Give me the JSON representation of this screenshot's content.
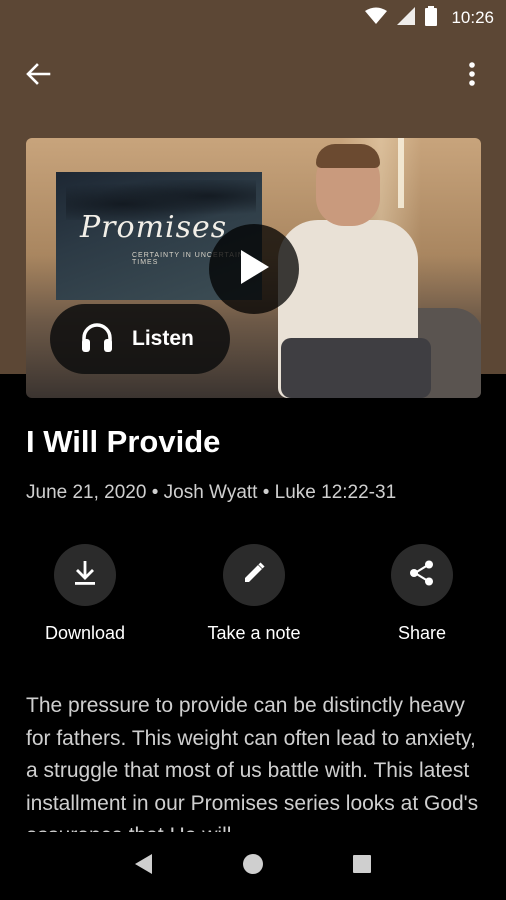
{
  "status_bar": {
    "time": "10:26",
    "icons": [
      "wifi-icon",
      "signal-icon",
      "battery-icon"
    ]
  },
  "app_bar": {
    "back_icon": "arrow-back-icon",
    "menu_icon": "more-vert-icon"
  },
  "video": {
    "thumbnail_series_title": "Promises",
    "thumbnail_series_subtitle": "CERTAINTY IN UNCERTAIN TIMES",
    "play_icon": "play-icon",
    "listen_label": "Listen",
    "listen_icon": "headphones-icon"
  },
  "sermon": {
    "title": "I Will Provide",
    "meta": "June 21, 2020 • Josh Wyatt • Luke 12:22-31"
  },
  "actions": [
    {
      "label": "Download",
      "icon": "download-icon"
    },
    {
      "label": "Take a note",
      "icon": "pencil-icon"
    },
    {
      "label": "Share",
      "icon": "share-icon"
    }
  ],
  "description": "The pressure to provide can be distinctly heavy for fathers. This weight can often lead to anxiety, a struggle that most of us battle with. This latest installment in our Promises series looks at God's assurance that He will",
  "nav_bar": {
    "icons": [
      "back-triangle-icon",
      "home-circle-icon",
      "recents-square-icon"
    ]
  },
  "colors": {
    "header_brown": "#5c4735",
    "background": "#000000",
    "action_circle": "#2b2b2b"
  }
}
